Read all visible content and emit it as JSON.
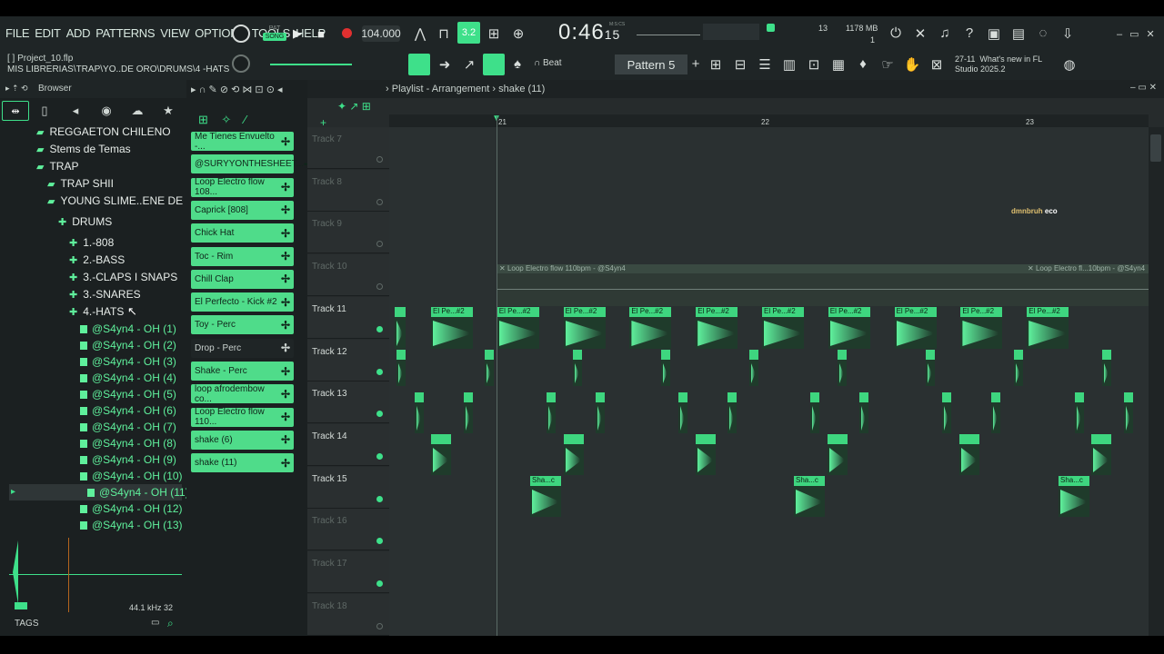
{
  "menu": [
    "FILE",
    "EDIT",
    "ADD",
    "PATTERNS",
    "VIEW",
    "OPTIONS",
    "TOOLS",
    "HELP"
  ],
  "project": {
    "title": "[ ] Project_10.flp",
    "path": "MIS LIBRERIAS\\TRAP\\YO..DE ORO\\DRUMS\\4 -HATS"
  },
  "transport": {
    "pat_label": "PAT",
    "song_label": "SONG",
    "tempo": "104.000",
    "time_main": "0:46",
    "time_sub": "15",
    "time_unit": "M:S:CS",
    "snap": "3.2"
  },
  "status": {
    "cpu": "13",
    "memory": "1178 MB",
    "mem_sub": "1",
    "pattern_name": "Pattern 5",
    "beat_label": "Beat",
    "news_date": "27-11",
    "news_text": "What's new in FL",
    "news_ver": "Studio 2025.2"
  },
  "browser": {
    "title": "Browser",
    "folders": [
      {
        "label": "REGGAETON CHILENO",
        "indent": 40
      },
      {
        "label": "Stems de Temas",
        "indent": 40
      },
      {
        "label": "TRAP",
        "indent": 40
      },
      {
        "label": "TRAP SHII",
        "indent": 52
      },
      {
        "label": "YOUNG SLIME..ENE DE ORO",
        "indent": 52
      },
      {
        "label": "DRUMS",
        "indent": 64
      },
      {
        "label": "1.-808",
        "indent": 76
      },
      {
        "label": "2.-BASS",
        "indent": 76
      },
      {
        "label": "3.-CLAPS I SNAPS",
        "indent": 76
      },
      {
        "label": "3.-SNARES",
        "indent": 76
      },
      {
        "label": "4.-HATS",
        "indent": 76
      }
    ],
    "files": [
      "@S4yn4 - OH (1)",
      "@S4yn4 - OH (2)",
      "@S4yn4 - OH (3)",
      "@S4yn4 - OH (4)",
      "@S4yn4 - OH (5)",
      "@S4yn4 - OH (6)",
      "@S4yn4 - OH (7)",
      "@S4yn4 - OH (8)",
      "@S4yn4 - OH (9)",
      "@S4yn4 - OH (10)",
      "@S4yn4 - OH (11)",
      "@S4yn4 - OH (12)",
      "@S4yn4 - OH (13)"
    ],
    "sample_rate": "44.1 kHz",
    "bits": "32",
    "tags": "TAGS"
  },
  "channels": [
    {
      "label": "Me Tienes Envuelto -...",
      "on": true
    },
    {
      "label": "@SURYYONTHESHEET...",
      "on": true
    },
    {
      "label": "Loop Electro flow 108...",
      "on": true
    },
    {
      "label": "Caprick [808]",
      "on": true
    },
    {
      "label": "Chick Hat",
      "on": true
    },
    {
      "label": "Toc - Rim",
      "on": true
    },
    {
      "label": "Chill Clap",
      "on": true
    },
    {
      "label": "El Perfecto - Kick #2",
      "on": true
    },
    {
      "label": "Toy - Perc",
      "on": true
    },
    {
      "label": "Drop - Perc",
      "on": false
    },
    {
      "label": "Shake - Perc",
      "on": true
    },
    {
      "label": "loop afrodembow co...",
      "on": true
    },
    {
      "label": "Loop Electro flow 110...",
      "on": true
    },
    {
      "label": "shake (6)",
      "on": true
    },
    {
      "label": "shake (11)",
      "on": true
    }
  ],
  "playlist": {
    "title": "Playlist - Arrangement",
    "pattern": "shake (11)",
    "bars": [
      "21",
      "22",
      "23"
    ],
    "tracks": [
      "Track 7",
      "Track 8",
      "Track 9",
      "Track 10",
      "Track 11",
      "Track 12",
      "Track 13",
      "Track 14",
      "Track 15",
      "Track 16",
      "Track 17",
      "Track 18"
    ],
    "loop_clip": "Loop Electro flow 110bpm - @S4yn4",
    "loop_clip2": "Loop Electro fl...10bpm - @S4yn4",
    "kick_clip": "El Pe...#2",
    "shake_clip": "Sha...c",
    "note1": "dmnbruh",
    "note2": "eco"
  },
  "colors": {
    "accent": "#3ee08a",
    "bg": "#262b2c"
  }
}
